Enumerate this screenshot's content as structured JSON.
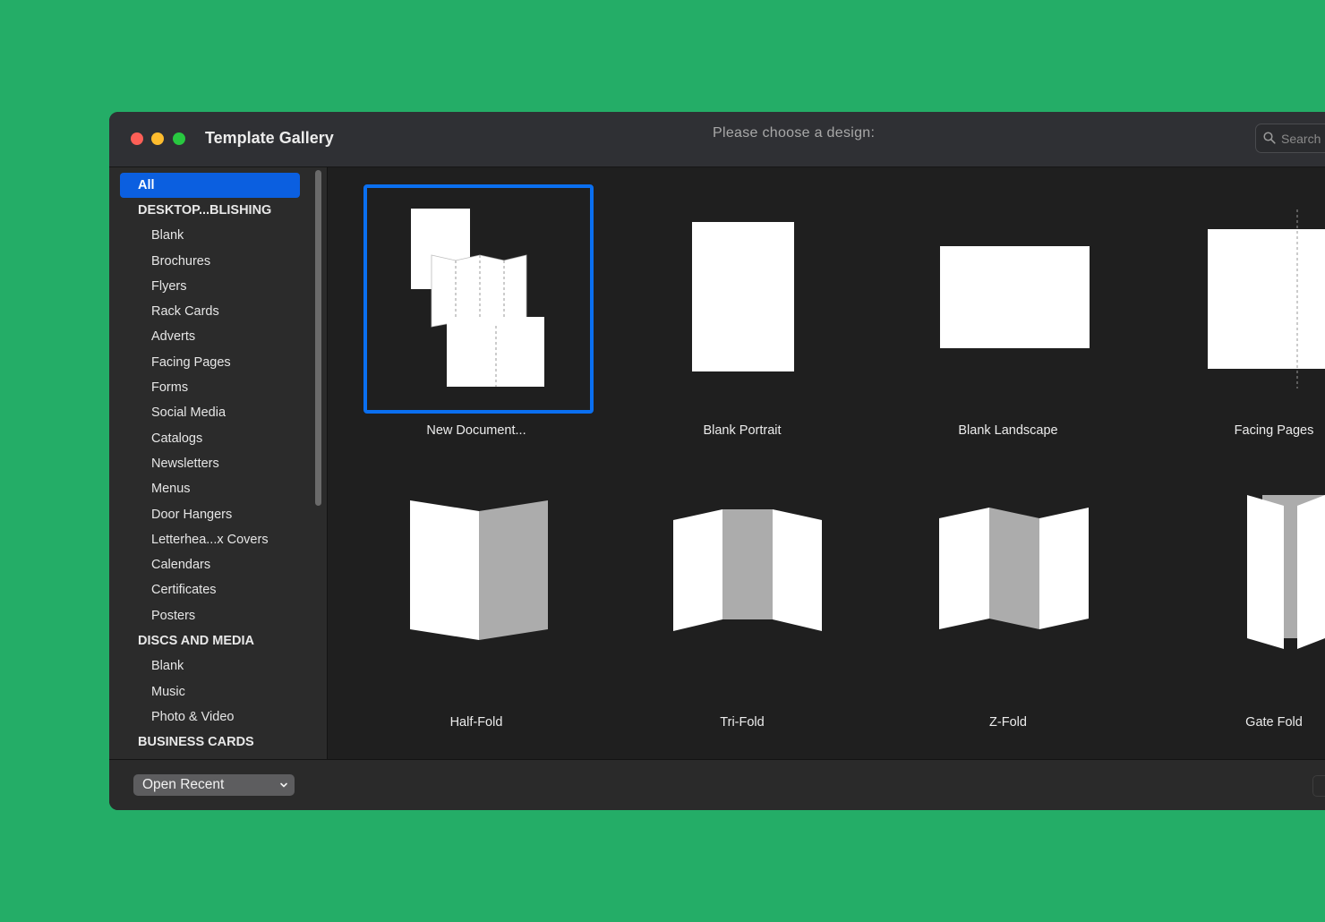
{
  "window": {
    "title": "Template Gallery",
    "prompt": "Please choose a design:",
    "search": {
      "placeholder": "Search"
    }
  },
  "sidebar": {
    "items": [
      {
        "label": "All",
        "kind": "selected"
      },
      {
        "label": "DESKTOP...BLISHING",
        "kind": "header"
      },
      {
        "label": "Blank",
        "kind": "item"
      },
      {
        "label": "Brochures",
        "kind": "item"
      },
      {
        "label": "Flyers",
        "kind": "item"
      },
      {
        "label": "Rack Cards",
        "kind": "item"
      },
      {
        "label": "Adverts",
        "kind": "item"
      },
      {
        "label": "Facing Pages",
        "kind": "item"
      },
      {
        "label": "Forms",
        "kind": "item"
      },
      {
        "label": "Social Media",
        "kind": "item"
      },
      {
        "label": "Catalogs",
        "kind": "item"
      },
      {
        "label": "Newsletters",
        "kind": "item"
      },
      {
        "label": "Menus",
        "kind": "item"
      },
      {
        "label": "Door Hangers",
        "kind": "item"
      },
      {
        "label": "Letterhea...x Covers",
        "kind": "item"
      },
      {
        "label": "Calendars",
        "kind": "item"
      },
      {
        "label": "Certificates",
        "kind": "item"
      },
      {
        "label": "Posters",
        "kind": "item"
      },
      {
        "label": "DISCS AND MEDIA",
        "kind": "header"
      },
      {
        "label": "Blank",
        "kind": "item"
      },
      {
        "label": "Music",
        "kind": "item"
      },
      {
        "label": "Photo & Video",
        "kind": "item"
      },
      {
        "label": "BUSINESS CARDS",
        "kind": "header"
      }
    ]
  },
  "gallery": {
    "templates": [
      {
        "label": "New Document...",
        "selected": true
      },
      {
        "label": "Blank Portrait"
      },
      {
        "label": "Blank Landscape"
      },
      {
        "label": "Facing Pages"
      },
      {
        "label": "Half-Fold"
      },
      {
        "label": "Tri-Fold"
      },
      {
        "label": "Z-Fold"
      },
      {
        "label": "Gate Fold"
      }
    ]
  },
  "footer": {
    "open_recent": "Open Recent"
  },
  "colors": {
    "accent": "#0b5fe0",
    "selection_border": "#0a6ff0",
    "desktop": "#24ad67"
  }
}
